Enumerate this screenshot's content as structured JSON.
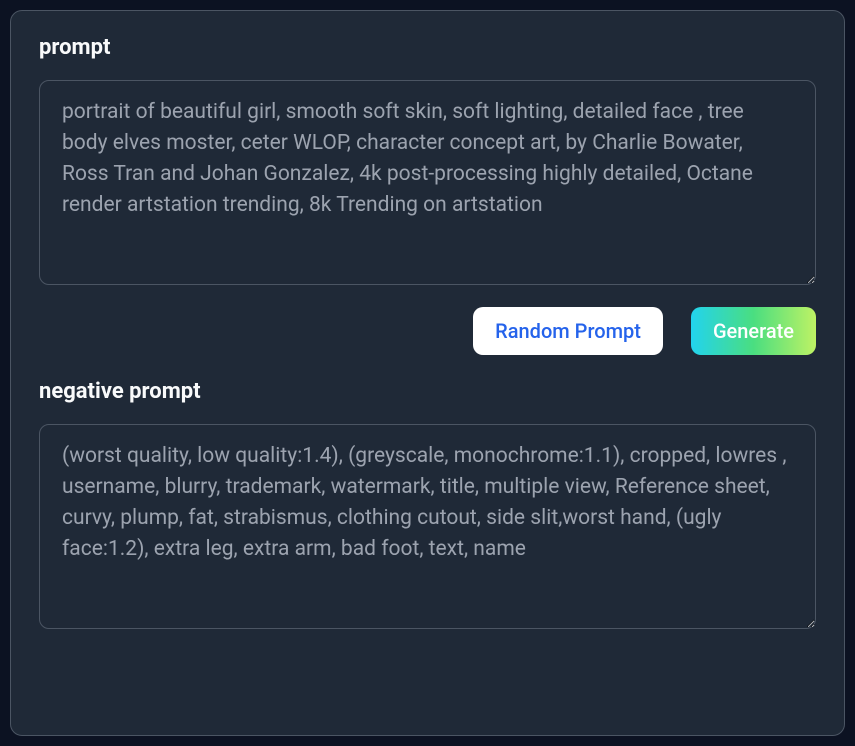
{
  "prompt": {
    "label": "prompt",
    "value": "portrait of beautiful girl, smooth soft skin, soft lighting, detailed face , tree body elves moster, ceter WLOP, character concept art, by Charlie Bowater, Ross Tran and Johan Gonzalez, 4k post-processing highly detailed, Octane render artstation trending, 8k Trending on artstation"
  },
  "buttons": {
    "random": "Random Prompt",
    "generate": "Generate"
  },
  "negative_prompt": {
    "label": "negative prompt",
    "value": "(worst quality, low quality:1.4), (greyscale, monochrome:1.1), cropped, lowres , username, blurry, trademark, watermark, title, multiple view, Reference sheet, curvy, plump, fat, strabismus, clothing cutout, side slit,worst hand, (ugly face:1.2), extra leg, extra arm, bad foot, text, name"
  }
}
